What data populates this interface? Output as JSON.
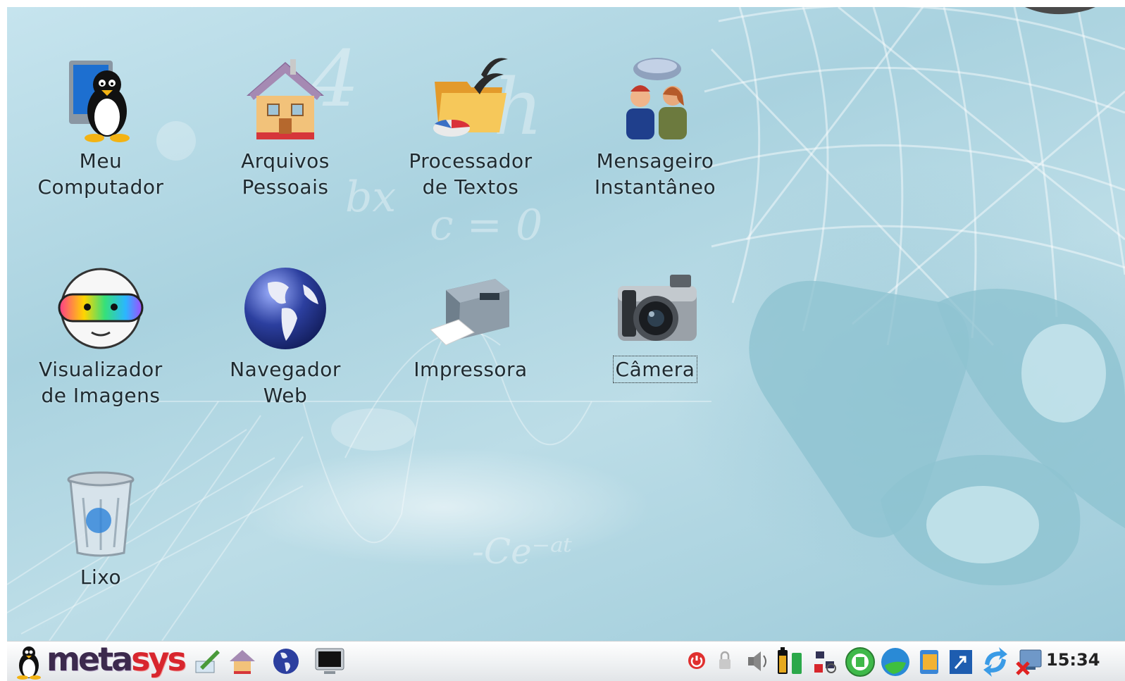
{
  "desktop": {
    "icons": [
      {
        "label": "Meu\nComputador",
        "icon": "computer-tux-icon"
      },
      {
        "label": "Arquivos\nPessoais",
        "icon": "home-folder-icon"
      },
      {
        "label": "Processador\nde Textos",
        "icon": "word-processor-icon"
      },
      {
        "label": "Mensageiro\nInstantâneo",
        "icon": "messenger-icon"
      },
      {
        "label": "Visualizador\nde Imagens",
        "icon": "image-viewer-icon"
      },
      {
        "label": "Navegador\nWeb",
        "icon": "web-browser-globe-icon"
      },
      {
        "label": "Impressora",
        "icon": "printer-icon"
      },
      {
        "label": "Câmera",
        "icon": "camera-icon"
      },
      {
        "label": "Lixo",
        "icon": "trash-icon"
      }
    ],
    "selected": "Câmera"
  },
  "taskbar": {
    "logo": {
      "text_main": "meta",
      "text_accent": "sys"
    },
    "quicklaunch": [
      "edit-icon",
      "home-icon",
      "globe-icon",
      "terminal-icon"
    ],
    "tray": [
      "power-icon",
      "lock-icon",
      "volume-icon",
      "battery-icon",
      "signal-icon",
      "network-search-icon",
      "circle-app-icon",
      "browser-icon",
      "notes-icon",
      "window-icon",
      "update-icon",
      "network-disconnected-icon"
    ],
    "clock": "15:34"
  },
  "colors": {
    "desktop_bg": "#b4d9e4",
    "label_text": "#1e2a30",
    "logo_accent": "#d8262e"
  }
}
